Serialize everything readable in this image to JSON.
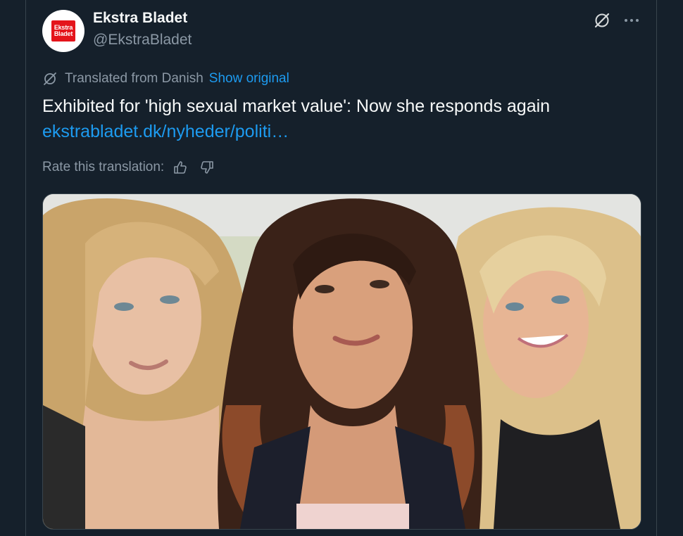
{
  "account": {
    "display_name": "Ekstra Bladet",
    "handle": "@EkstraBladet",
    "avatar_logo_line1": "Ekstra",
    "avatar_logo_line2": "Bladet"
  },
  "translation": {
    "label": "Translated from Danish",
    "show_original": "Show original"
  },
  "tweet": {
    "text": "Exhibited for 'high sexual market value': Now she responds again",
    "link": "ekstrabladet.dk/nyheder/politi…"
  },
  "rating": {
    "label": "Rate this translation:"
  },
  "icons": {
    "grok": "grok-icon",
    "more": "more-icon",
    "translate": "translate-icon",
    "thumbs_up": "thumbs-up-icon",
    "thumbs_down": "thumbs-down-icon"
  },
  "colors": {
    "background": "#15202b",
    "primary_text": "#f7f9f9",
    "secondary_text": "#8b98a5",
    "link": "#1d9bf0",
    "border": "#38444d",
    "brand_red": "#e4141b"
  }
}
